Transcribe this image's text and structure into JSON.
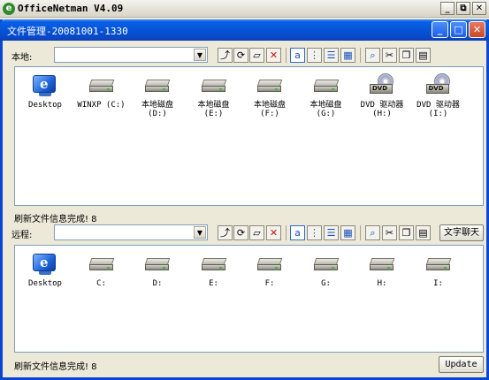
{
  "app": {
    "title": "OfficeNetman V4.09",
    "icon_glyph": "e",
    "controls": {
      "minimize": "_",
      "restore": "⧉",
      "close": "✕"
    }
  },
  "file_window": {
    "title": "文件管理-20081001-1330",
    "controls": {
      "minimize": "_",
      "maximize": "□",
      "close": "✕"
    }
  },
  "local": {
    "label": "本地:",
    "path_value": "",
    "items": [
      {
        "name": "Desktop",
        "icon": "desktop-icon"
      },
      {
        "name": "WINXP (C:)",
        "icon": "drive-icon"
      },
      {
        "name": "本地磁盘\n(D:)",
        "icon": "drive-icon"
      },
      {
        "name": "本地磁盘\n(E:)",
        "icon": "drive-icon"
      },
      {
        "name": "本地磁盘\n(F:)",
        "icon": "drive-icon"
      },
      {
        "name": "本地磁盘\n(G:)",
        "icon": "drive-icon"
      },
      {
        "name": "DVD 驱动器\n(H:)",
        "icon": "dvd-drive-icon"
      },
      {
        "name": "DVD 驱动器\n(I:)",
        "icon": "dvd-drive-icon"
      }
    ],
    "status": "刷新文件信息完成! 8"
  },
  "remote": {
    "label": "远程:",
    "path_value": "",
    "chat_button": "文字聊天",
    "items": [
      {
        "name": "Desktop",
        "icon": "desktop-icon"
      },
      {
        "name": "C:",
        "icon": "drive-icon"
      },
      {
        "name": "D:",
        "icon": "drive-icon"
      },
      {
        "name": "E:",
        "icon": "drive-icon"
      },
      {
        "name": "F:",
        "icon": "drive-icon"
      },
      {
        "name": "G:",
        "icon": "drive-icon"
      },
      {
        "name": "H:",
        "icon": "drive-icon"
      },
      {
        "name": "I:",
        "icon": "drive-icon"
      }
    ],
    "status": "刷新文件信息完成! 8",
    "update_button": "Update"
  },
  "toolbar_icons": {
    "up_folder": "⤴",
    "refresh": "⟳",
    "new_folder": "▱",
    "delete": "✕",
    "view_large": "a",
    "view_small": "⋮",
    "view_list": "☰",
    "view_details": "▦",
    "find": "⌕",
    "cut": "✂",
    "copy": "❐",
    "paste": "▤"
  },
  "colors": {
    "title_blue": "#0554d8",
    "face": "#ece9d8",
    "close_red": "#c94726"
  }
}
